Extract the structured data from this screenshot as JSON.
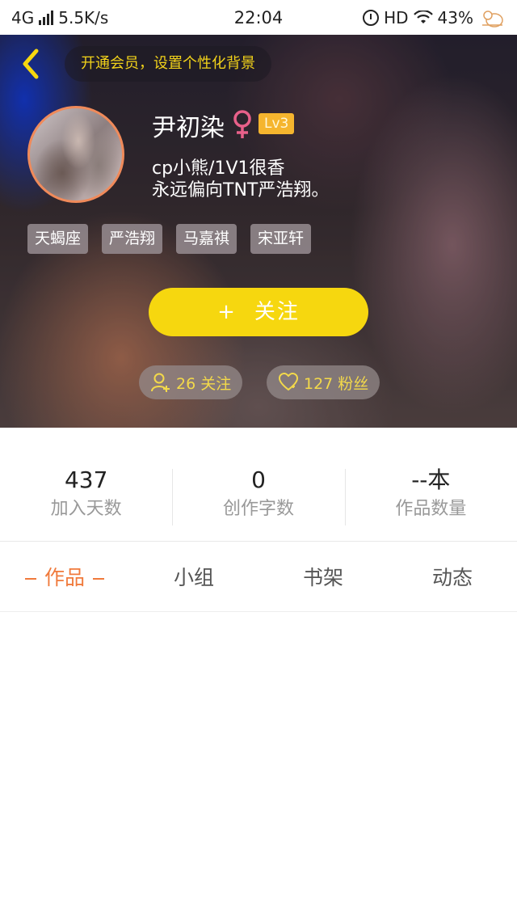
{
  "status_bar": {
    "network": "4G",
    "speed": "5.5K/s",
    "time": "22:04",
    "hd": "HD",
    "battery": "43%",
    "icons": [
      "signal-icon",
      "alarm-icon",
      "wifi-icon",
      "mascot-icon"
    ]
  },
  "header": {
    "vip_banner": "开通会员，设置个性化背景",
    "username": "尹初染",
    "gender_symbol": "♀",
    "level": "Lv3",
    "bio_line_1": "cp小熊/1V1很香",
    "bio_line_2": "永远偏向TNT严浩翔。",
    "tags": [
      "天蝎座",
      "严浩翔",
      "马嘉祺",
      "宋亚轩"
    ],
    "follow_plus": "+",
    "follow_label": "关注",
    "following_text": "26 关注",
    "fans_text": "127 粉丝",
    "colors": {
      "accent_yellow": "#f6d70f",
      "gender_pink": "#e8608a",
      "level_badge": "#f5b52e",
      "pill_text": "#f3d94a"
    }
  },
  "stats": [
    {
      "value": "437",
      "label": "加入天数"
    },
    {
      "value": "0",
      "label": "创作字数"
    },
    {
      "value": "--本",
      "label": "作品数量"
    }
  ],
  "tabs": [
    {
      "label": "作品",
      "active": true
    },
    {
      "label": "小组",
      "active": false
    },
    {
      "label": "书架",
      "active": false
    },
    {
      "label": "动态",
      "active": false
    }
  ],
  "active_color": "#f07a3c"
}
